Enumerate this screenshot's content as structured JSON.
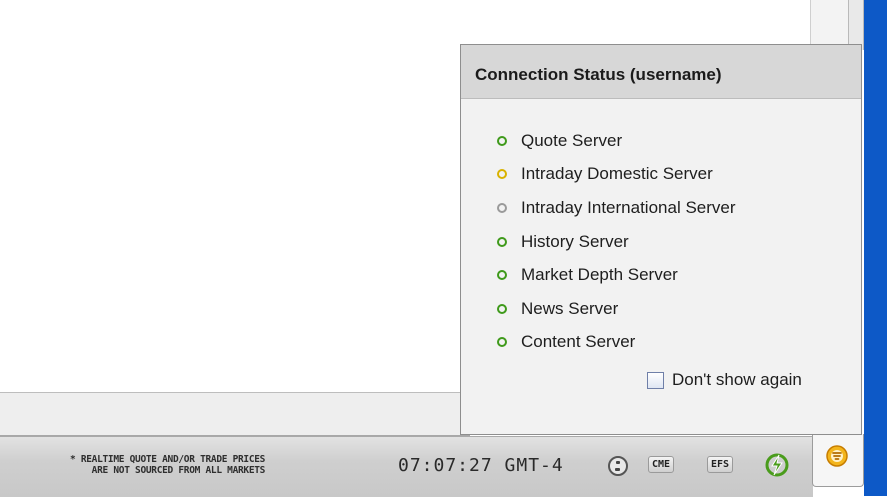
{
  "popup": {
    "title": "Connection Status  (username)",
    "servers": [
      {
        "label": "Quote Server",
        "status_color": "#3f9a1b"
      },
      {
        "label": "Intraday Domestic Server",
        "status_color": "#d9b200"
      },
      {
        "label": "Intraday International Server",
        "status_color": "#9a9a9a"
      },
      {
        "label": "History Server",
        "status_color": "#3f9a1b"
      },
      {
        "label": "Market Depth Server",
        "status_color": "#3f9a1b"
      },
      {
        "label": "News Server",
        "status_color": "#3f9a1b"
      },
      {
        "label": "Content Server",
        "status_color": "#3f9a1b"
      }
    ],
    "dont_show_label": "Don't show again",
    "dont_show_checked": false
  },
  "statusbar": {
    "disclaimer_line1": "* REALTIME QUOTE AND/OR TRADE PRICES",
    "disclaimer_line2": "ARE NOT SOURCED FROM ALL MARKETS",
    "clock": "07:07:27 GMT-4",
    "globe_icon": "globe-icon",
    "cme_label": "CME",
    "efs_label": "EFS",
    "connection_icon": "lightning-bolt-icon",
    "tab_icon": "connection-status-icon"
  },
  "colors": {
    "accent_blue": "#0d59c7",
    "status_green": "#3f9a1b",
    "status_yellow": "#d9b200",
    "status_gray": "#9a9a9a"
  }
}
